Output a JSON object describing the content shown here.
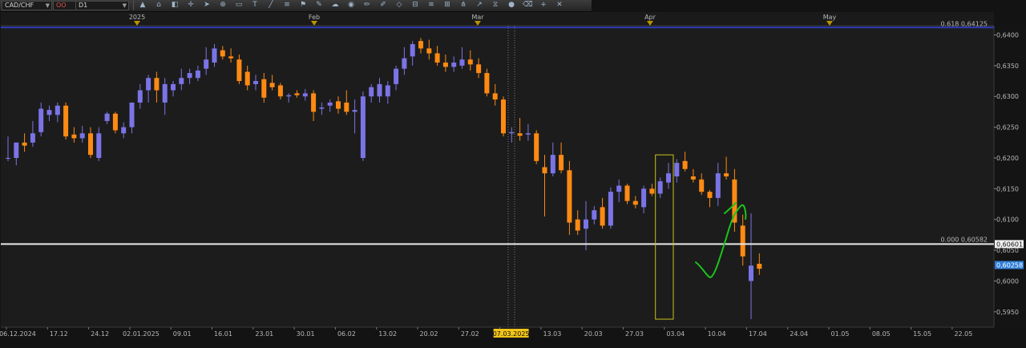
{
  "toolbar": {
    "symbol": "CAD/CHF",
    "period": "D1",
    "chart_style": "OO",
    "icons": [
      "line-chart-icon",
      "indicator-icon",
      "template-icon",
      "crosshair-icon",
      "cursor-icon",
      "zoom-icon",
      "ruler-icon",
      "text-icon",
      "trendline-icon",
      "object-list-icon",
      "flag-icon",
      "note-icon",
      "cloud-icon",
      "globe-icon",
      "pencil-icon",
      "brush-icon",
      "shapes-icon",
      "fib-icon",
      "channel-icon",
      "gann-icon",
      "pitchfork-icon",
      "arrow-icon",
      "magnet-icon",
      "sphere-icon",
      "eraser-icon",
      "plus-icon",
      "delete-icon"
    ]
  },
  "colors": {
    "background": "#131313",
    "plot_bg": "#1c1c1c",
    "bull": "#7b74e6",
    "bear": "#ff8a13",
    "horizontal_line": "#e8e8e8",
    "blue_line": "#2d3db8",
    "highlight_box": "#c9c31a",
    "drawn_arrow": "#19c419",
    "marker": "#b89400"
  },
  "chart_data": {
    "type": "candlestick",
    "symbol": "CAD/CHF",
    "period": "D1",
    "ylim": [
      0.5925,
      0.6415
    ],
    "y_ticks": [
      "0,6400",
      "0,6350",
      "0,6300",
      "0,6250",
      "0,6200",
      "0,6150",
      "0,6100",
      "0,6050",
      "0,6000",
      "0,5950"
    ],
    "x_tick_labels": [
      "06.12.2024",
      "17.12",
      "24.12",
      "02.01.2025",
      "09.01",
      "16.01",
      "23.01",
      "30.01",
      "06.02",
      "13.02",
      "20.02",
      "27.02",
      "07.03.2025",
      "13.03",
      "20.03",
      "27.03",
      "03.04",
      "10.04",
      "17.04",
      "24.04",
      "01.05",
      "08.05",
      "15.05",
      "22.05"
    ],
    "highlighted_x_label": "07.03.2025",
    "period_separators": [
      "2025",
      "Feb",
      "Mar",
      "Apr",
      "May"
    ],
    "horizontal_lines": [
      {
        "label": "0.000  0,60582",
        "price": 0.606,
        "axis_label": "0,60601"
      },
      {
        "label": "0.618  0,64125",
        "price": 0.6412
      }
    ],
    "current_price_label": "0,60258",
    "current_price": 0.6026,
    "crosshair_date": "07.03.2025",
    "candles": [
      {
        "o": 0.62,
        "h": 0.6235,
        "l": 0.6195,
        "c": 0.62
      },
      {
        "o": 0.62,
        "h": 0.6225,
        "l": 0.6188,
        "c": 0.6225
      },
      {
        "o": 0.6225,
        "h": 0.624,
        "l": 0.621,
        "c": 0.622
      },
      {
        "o": 0.6225,
        "h": 0.626,
        "l": 0.6218,
        "c": 0.624
      },
      {
        "o": 0.6242,
        "h": 0.629,
        "l": 0.6235,
        "c": 0.628
      },
      {
        "o": 0.627,
        "h": 0.6285,
        "l": 0.626,
        "c": 0.6278
      },
      {
        "o": 0.627,
        "h": 0.629,
        "l": 0.6258,
        "c": 0.6285
      },
      {
        "o": 0.6285,
        "h": 0.629,
        "l": 0.623,
        "c": 0.6235
      },
      {
        "o": 0.6238,
        "h": 0.625,
        "l": 0.6225,
        "c": 0.6232
      },
      {
        "o": 0.6232,
        "h": 0.6252,
        "l": 0.6225,
        "c": 0.624
      },
      {
        "o": 0.624,
        "h": 0.625,
        "l": 0.62,
        "c": 0.6205
      },
      {
        "o": 0.62,
        "h": 0.625,
        "l": 0.6195,
        "c": 0.624
      },
      {
        "o": 0.626,
        "h": 0.6275,
        "l": 0.6255,
        "c": 0.6272
      },
      {
        "o": 0.6272,
        "h": 0.6275,
        "l": 0.624,
        "c": 0.6245
      },
      {
        "o": 0.624,
        "h": 0.6258,
        "l": 0.6232,
        "c": 0.625
      },
      {
        "o": 0.625,
        "h": 0.629,
        "l": 0.624,
        "c": 0.629
      },
      {
        "o": 0.629,
        "h": 0.632,
        "l": 0.628,
        "c": 0.631
      },
      {
        "o": 0.631,
        "h": 0.6335,
        "l": 0.629,
        "c": 0.633
      },
      {
        "o": 0.633,
        "h": 0.634,
        "l": 0.629,
        "c": 0.631
      },
      {
        "o": 0.629,
        "h": 0.633,
        "l": 0.627,
        "c": 0.632
      },
      {
        "o": 0.631,
        "h": 0.6325,
        "l": 0.63,
        "c": 0.632
      },
      {
        "o": 0.632,
        "h": 0.6345,
        "l": 0.631,
        "c": 0.633
      },
      {
        "o": 0.633,
        "h": 0.6345,
        "l": 0.632,
        "c": 0.6338
      },
      {
        "o": 0.633,
        "h": 0.635,
        "l": 0.6325,
        "c": 0.6342
      },
      {
        "o": 0.6345,
        "h": 0.638,
        "l": 0.6335,
        "c": 0.636
      },
      {
        "o": 0.6355,
        "h": 0.6385,
        "l": 0.6348,
        "c": 0.6378
      },
      {
        "o": 0.6375,
        "h": 0.6382,
        "l": 0.636,
        "c": 0.6365
      },
      {
        "o": 0.6365,
        "h": 0.6378,
        "l": 0.6355,
        "c": 0.6362
      },
      {
        "o": 0.636,
        "h": 0.6368,
        "l": 0.632,
        "c": 0.6325
      },
      {
        "o": 0.634,
        "h": 0.635,
        "l": 0.631,
        "c": 0.6318
      },
      {
        "o": 0.632,
        "h": 0.6335,
        "l": 0.631,
        "c": 0.6325
      },
      {
        "o": 0.6328,
        "h": 0.6338,
        "l": 0.629,
        "c": 0.6298
      },
      {
        "o": 0.6322,
        "h": 0.6335,
        "l": 0.631,
        "c": 0.6315
      },
      {
        "o": 0.6318,
        "h": 0.6322,
        "l": 0.6295,
        "c": 0.63
      },
      {
        "o": 0.63,
        "h": 0.6305,
        "l": 0.629,
        "c": 0.6302
      },
      {
        "o": 0.6305,
        "h": 0.631,
        "l": 0.6298,
        "c": 0.6302
      },
      {
        "o": 0.63,
        "h": 0.6312,
        "l": 0.6293,
        "c": 0.6305
      },
      {
        "o": 0.6305,
        "h": 0.631,
        "l": 0.626,
        "c": 0.6275
      },
      {
        "o": 0.628,
        "h": 0.629,
        "l": 0.627,
        "c": 0.6282
      },
      {
        "o": 0.6285,
        "h": 0.6295,
        "l": 0.6275,
        "c": 0.629
      },
      {
        "o": 0.6292,
        "h": 0.63,
        "l": 0.6272,
        "c": 0.628
      },
      {
        "o": 0.629,
        "h": 0.631,
        "l": 0.627,
        "c": 0.6275
      },
      {
        "o": 0.6275,
        "h": 0.6295,
        "l": 0.624,
        "c": 0.6278
      },
      {
        "o": 0.62,
        "h": 0.6308,
        "l": 0.6195,
        "c": 0.63
      },
      {
        "o": 0.63,
        "h": 0.632,
        "l": 0.629,
        "c": 0.6315
      },
      {
        "o": 0.63,
        "h": 0.633,
        "l": 0.629,
        "c": 0.632
      },
      {
        "o": 0.63,
        "h": 0.6325,
        "l": 0.6288,
        "c": 0.6318
      },
      {
        "o": 0.632,
        "h": 0.635,
        "l": 0.631,
        "c": 0.6345
      },
      {
        "o": 0.6345,
        "h": 0.638,
        "l": 0.6335,
        "c": 0.6362
      },
      {
        "o": 0.6365,
        "h": 0.639,
        "l": 0.635,
        "c": 0.6385
      },
      {
        "o": 0.639,
        "h": 0.6395,
        "l": 0.637,
        "c": 0.6378
      },
      {
        "o": 0.6378,
        "h": 0.6392,
        "l": 0.636,
        "c": 0.637
      },
      {
        "o": 0.637,
        "h": 0.6382,
        "l": 0.635,
        "c": 0.6355
      },
      {
        "o": 0.6355,
        "h": 0.6368,
        "l": 0.634,
        "c": 0.6348
      },
      {
        "o": 0.6348,
        "h": 0.6365,
        "l": 0.634,
        "c": 0.6355
      },
      {
        "o": 0.635,
        "h": 0.638,
        "l": 0.6345,
        "c": 0.636
      },
      {
        "o": 0.636,
        "h": 0.6375,
        "l": 0.6342,
        "c": 0.6352
      },
      {
        "o": 0.6352,
        "h": 0.6362,
        "l": 0.633,
        "c": 0.6338
      },
      {
        "o": 0.6338,
        "h": 0.6345,
        "l": 0.63,
        "c": 0.6305
      },
      {
        "o": 0.6305,
        "h": 0.632,
        "l": 0.6285,
        "c": 0.6295
      },
      {
        "o": 0.6295,
        "h": 0.63,
        "l": 0.6235,
        "c": 0.624
      },
      {
        "o": 0.624,
        "h": 0.625,
        "l": 0.6225,
        "c": 0.6242
      },
      {
        "o": 0.624,
        "h": 0.6265,
        "l": 0.6228,
        "c": 0.6236
      },
      {
        "o": 0.6238,
        "h": 0.6255,
        "l": 0.6228,
        "c": 0.624
      },
      {
        "o": 0.624,
        "h": 0.6245,
        "l": 0.619,
        "c": 0.6195
      },
      {
        "o": 0.6185,
        "h": 0.6205,
        "l": 0.6105,
        "c": 0.6175
      },
      {
        "o": 0.6175,
        "h": 0.6225,
        "l": 0.617,
        "c": 0.6205
      },
      {
        "o": 0.6205,
        "h": 0.6225,
        "l": 0.6175,
        "c": 0.618
      },
      {
        "o": 0.618,
        "h": 0.6195,
        "l": 0.6075,
        "c": 0.6095
      },
      {
        "o": 0.61,
        "h": 0.6115,
        "l": 0.6075,
        "c": 0.6082
      },
      {
        "o": 0.6085,
        "h": 0.613,
        "l": 0.605,
        "c": 0.61
      },
      {
        "o": 0.61,
        "h": 0.6122,
        "l": 0.6092,
        "c": 0.6115
      },
      {
        "o": 0.612,
        "h": 0.6135,
        "l": 0.6085,
        "c": 0.609
      },
      {
        "o": 0.609,
        "h": 0.6152,
        "l": 0.6085,
        "c": 0.6145
      },
      {
        "o": 0.6145,
        "h": 0.6165,
        "l": 0.6128,
        "c": 0.6155
      },
      {
        "o": 0.6155,
        "h": 0.6158,
        "l": 0.6125,
        "c": 0.613
      },
      {
        "o": 0.613,
        "h": 0.6138,
        "l": 0.6118,
        "c": 0.6124
      },
      {
        "o": 0.612,
        "h": 0.6155,
        "l": 0.611,
        "c": 0.615
      },
      {
        "o": 0.615,
        "h": 0.6158,
        "l": 0.6138,
        "c": 0.6142
      },
      {
        "o": 0.6142,
        "h": 0.6168,
        "l": 0.6135,
        "c": 0.6162
      },
      {
        "o": 0.616,
        "h": 0.6192,
        "l": 0.615,
        "c": 0.6175
      },
      {
        "o": 0.617,
        "h": 0.6198,
        "l": 0.616,
        "c": 0.6192
      },
      {
        "o": 0.6195,
        "h": 0.621,
        "l": 0.6178,
        "c": 0.6182
      },
      {
        "o": 0.617,
        "h": 0.6182,
        "l": 0.616,
        "c": 0.6165
      },
      {
        "o": 0.6165,
        "h": 0.6175,
        "l": 0.614,
        "c": 0.6145
      },
      {
        "o": 0.6145,
        "h": 0.6148,
        "l": 0.612,
        "c": 0.6135
      },
      {
        "o": 0.6135,
        "h": 0.6192,
        "l": 0.6122,
        "c": 0.6175
      },
      {
        "o": 0.6175,
        "h": 0.6202,
        "l": 0.6165,
        "c": 0.617
      },
      {
        "o": 0.6165,
        "h": 0.6182,
        "l": 0.608,
        "c": 0.6095
      },
      {
        "o": 0.609,
        "h": 0.6108,
        "l": 0.6025,
        "c": 0.604
      },
      {
        "o": 0.6,
        "h": 0.611,
        "l": 0.5938,
        "c": 0.6025
      },
      {
        "o": 0.6028,
        "h": 0.6045,
        "l": 0.601,
        "c": 0.602
      }
    ],
    "annotations": [
      "highlight-box",
      "hand-drawn-arrow"
    ]
  }
}
